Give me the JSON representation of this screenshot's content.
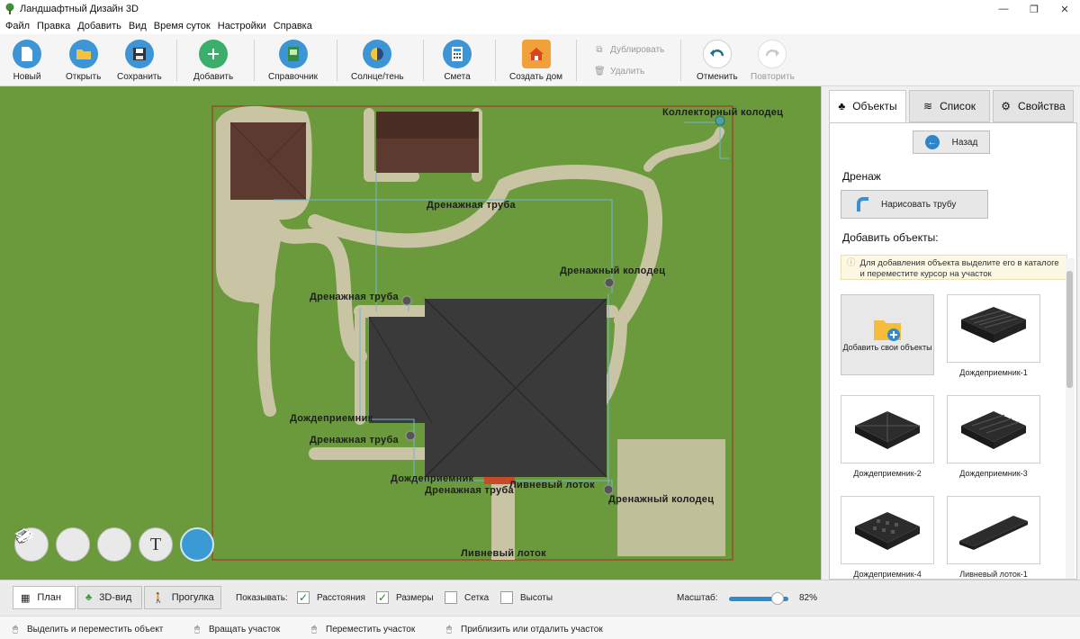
{
  "window": {
    "title": "Ландшафтный Дизайн 3D",
    "controls": [
      "—",
      "❐",
      "✕"
    ]
  },
  "menu": [
    "Файл",
    "Правка",
    "Добавить",
    "Вид",
    "Время суток",
    "Настройки",
    "Справка"
  ],
  "toolbar": {
    "new": "Новый",
    "open": "Открыть",
    "save": "Сохранить",
    "add": "Добавить",
    "reference": "Справочник",
    "sun_shadow": "Солнце/тень",
    "estimate": "Смета",
    "create_house": "Создать дом",
    "duplicate": "Дублировать",
    "delete": "Удалить",
    "undo": "Отменить",
    "redo": "Повторить"
  },
  "map_labels": {
    "collector_well": "Коллекторный колодец",
    "drain_pipe_1": "Дренажная труба",
    "drain_well_1": "Дренажный колодец",
    "drain_pipe_2": "Дренажная труба",
    "rain_inlet_1": "Дождеприемник",
    "drain_pipe_3": "Дренажная труба",
    "rain_inlet_2": "Дождеприемник",
    "rain_channel_1": "Ливневый лоток",
    "drain_pipe_4": "Дренажная труба",
    "drain_well_2": "Дренажный колодец",
    "rain_channel_2": "Ливневый лоток"
  },
  "panel": {
    "tabs": {
      "objects": "Объекты",
      "list": "Список",
      "properties": "Свойства"
    },
    "back": "Назад",
    "section": "Дренаж",
    "draw_pipe": "Нарисовать трубу",
    "add_objects": "Добавить объекты:",
    "hint": "Для добавления объекта выделите его в каталоге и переместите курсор на участок",
    "add_own": "Добавить свои объекты",
    "items": [
      "Дождеприемник-1",
      "Дождеприемник-2",
      "Дождеприемник-3",
      "Дождеприемник-4",
      "Ливневый лоток-1"
    ]
  },
  "views": {
    "plan": "План",
    "view3d": "3D-вид",
    "walk": "Прогулка"
  },
  "show": {
    "label": "Показывать:",
    "distances": "Расстояния",
    "distances_on": true,
    "sizes": "Размеры",
    "sizes_on": true,
    "grid": "Сетка",
    "grid_on": false,
    "heights": "Высоты",
    "heights_on": false
  },
  "scale": {
    "label": "Масштаб:",
    "value": "82%",
    "fraction": 0.82
  },
  "status": {
    "select": "Выделить и переместить объект",
    "rotate": "Вращать участок",
    "move": "Переместить участок",
    "zoom": "Приблизить или отдалить участок"
  },
  "colors": {
    "accent": "#2e8bcf",
    "lawn": "#6a9a3c",
    "path": "#c9c4a4",
    "roof": "#3a3a3a",
    "shed_roof": "#5c3a30"
  }
}
